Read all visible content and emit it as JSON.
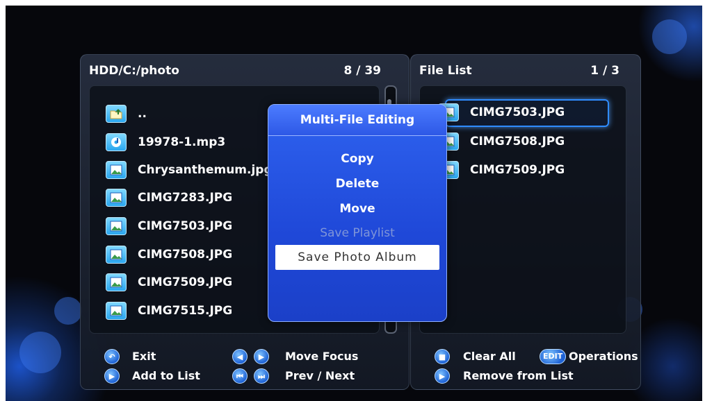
{
  "browser": {
    "path": "HDD/C:/photo",
    "page": "8 / 39",
    "items": [
      {
        "name": "..",
        "icon": "folder-up-icon"
      },
      {
        "name": "19978-1.mp3",
        "icon": "music-file-icon"
      },
      {
        "name": "Chrysanthemum.jpg",
        "icon": "photo-file-icon"
      },
      {
        "name": "CIMG7283.JPG",
        "icon": "photo-file-icon"
      },
      {
        "name": "CIMG7503.JPG",
        "icon": "photo-file-icon"
      },
      {
        "name": "CIMG7508.JPG",
        "icon": "photo-file-icon"
      },
      {
        "name": "CIMG7509.JPG",
        "icon": "photo-file-icon"
      },
      {
        "name": "CIMG7515.JPG",
        "icon": "photo-file-icon"
      }
    ]
  },
  "file_list": {
    "title": "File List",
    "page": "1 / 3",
    "items": [
      {
        "name": "CIMG7503.JPG"
      },
      {
        "name": "CIMG7508.JPG"
      },
      {
        "name": "CIMG7509.JPG"
      }
    ]
  },
  "dialog": {
    "title": "Multi-File Editing",
    "items": [
      {
        "label": "Copy",
        "state": "enabled"
      },
      {
        "label": "Delete",
        "state": "enabled"
      },
      {
        "label": "Move",
        "state": "enabled"
      },
      {
        "label": "Save Playlist",
        "state": "disabled"
      },
      {
        "label": "Save Photo Album",
        "state": "focused"
      }
    ]
  },
  "legend_left": {
    "exit": "Exit",
    "add_to_list": "Add to List",
    "move_focus": "Move Focus",
    "prev_next": "Prev / Next"
  },
  "legend_right": {
    "clear_all": "Clear All",
    "edit_key": "EDIT",
    "operations": "Operations",
    "remove_from_list": "Remove from List"
  },
  "colors": {
    "accent": "#2f8cff",
    "dialog_bg": "#1f48d8",
    "background": "#06070c"
  }
}
